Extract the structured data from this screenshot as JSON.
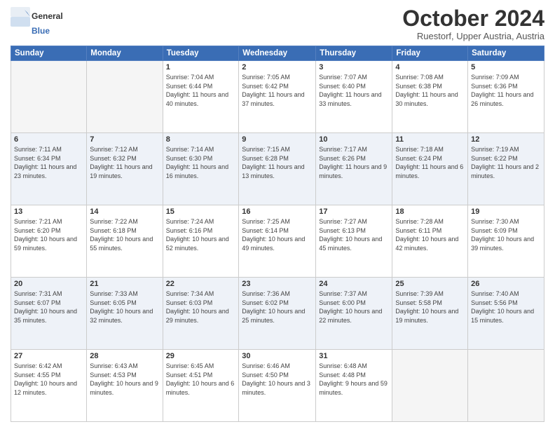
{
  "header": {
    "logo_line1": "General",
    "logo_line2": "Blue",
    "month": "October 2024",
    "location": "Ruestorf, Upper Austria, Austria"
  },
  "weekdays": [
    "Sunday",
    "Monday",
    "Tuesday",
    "Wednesday",
    "Thursday",
    "Friday",
    "Saturday"
  ],
  "weeks": [
    [
      {
        "day": "",
        "info": ""
      },
      {
        "day": "",
        "info": ""
      },
      {
        "day": "1",
        "info": "Sunrise: 7:04 AM\nSunset: 6:44 PM\nDaylight: 11 hours and 40 minutes."
      },
      {
        "day": "2",
        "info": "Sunrise: 7:05 AM\nSunset: 6:42 PM\nDaylight: 11 hours and 37 minutes."
      },
      {
        "day": "3",
        "info": "Sunrise: 7:07 AM\nSunset: 6:40 PM\nDaylight: 11 hours and 33 minutes."
      },
      {
        "day": "4",
        "info": "Sunrise: 7:08 AM\nSunset: 6:38 PM\nDaylight: 11 hours and 30 minutes."
      },
      {
        "day": "5",
        "info": "Sunrise: 7:09 AM\nSunset: 6:36 PM\nDaylight: 11 hours and 26 minutes."
      }
    ],
    [
      {
        "day": "6",
        "info": "Sunrise: 7:11 AM\nSunset: 6:34 PM\nDaylight: 11 hours and 23 minutes."
      },
      {
        "day": "7",
        "info": "Sunrise: 7:12 AM\nSunset: 6:32 PM\nDaylight: 11 hours and 19 minutes."
      },
      {
        "day": "8",
        "info": "Sunrise: 7:14 AM\nSunset: 6:30 PM\nDaylight: 11 hours and 16 minutes."
      },
      {
        "day": "9",
        "info": "Sunrise: 7:15 AM\nSunset: 6:28 PM\nDaylight: 11 hours and 13 minutes."
      },
      {
        "day": "10",
        "info": "Sunrise: 7:17 AM\nSunset: 6:26 PM\nDaylight: 11 hours and 9 minutes."
      },
      {
        "day": "11",
        "info": "Sunrise: 7:18 AM\nSunset: 6:24 PM\nDaylight: 11 hours and 6 minutes."
      },
      {
        "day": "12",
        "info": "Sunrise: 7:19 AM\nSunset: 6:22 PM\nDaylight: 11 hours and 2 minutes."
      }
    ],
    [
      {
        "day": "13",
        "info": "Sunrise: 7:21 AM\nSunset: 6:20 PM\nDaylight: 10 hours and 59 minutes."
      },
      {
        "day": "14",
        "info": "Sunrise: 7:22 AM\nSunset: 6:18 PM\nDaylight: 10 hours and 55 minutes."
      },
      {
        "day": "15",
        "info": "Sunrise: 7:24 AM\nSunset: 6:16 PM\nDaylight: 10 hours and 52 minutes."
      },
      {
        "day": "16",
        "info": "Sunrise: 7:25 AM\nSunset: 6:14 PM\nDaylight: 10 hours and 49 minutes."
      },
      {
        "day": "17",
        "info": "Sunrise: 7:27 AM\nSunset: 6:13 PM\nDaylight: 10 hours and 45 minutes."
      },
      {
        "day": "18",
        "info": "Sunrise: 7:28 AM\nSunset: 6:11 PM\nDaylight: 10 hours and 42 minutes."
      },
      {
        "day": "19",
        "info": "Sunrise: 7:30 AM\nSunset: 6:09 PM\nDaylight: 10 hours and 39 minutes."
      }
    ],
    [
      {
        "day": "20",
        "info": "Sunrise: 7:31 AM\nSunset: 6:07 PM\nDaylight: 10 hours and 35 minutes."
      },
      {
        "day": "21",
        "info": "Sunrise: 7:33 AM\nSunset: 6:05 PM\nDaylight: 10 hours and 32 minutes."
      },
      {
        "day": "22",
        "info": "Sunrise: 7:34 AM\nSunset: 6:03 PM\nDaylight: 10 hours and 29 minutes."
      },
      {
        "day": "23",
        "info": "Sunrise: 7:36 AM\nSunset: 6:02 PM\nDaylight: 10 hours and 25 minutes."
      },
      {
        "day": "24",
        "info": "Sunrise: 7:37 AM\nSunset: 6:00 PM\nDaylight: 10 hours and 22 minutes."
      },
      {
        "day": "25",
        "info": "Sunrise: 7:39 AM\nSunset: 5:58 PM\nDaylight: 10 hours and 19 minutes."
      },
      {
        "day": "26",
        "info": "Sunrise: 7:40 AM\nSunset: 5:56 PM\nDaylight: 10 hours and 15 minutes."
      }
    ],
    [
      {
        "day": "27",
        "info": "Sunrise: 6:42 AM\nSunset: 4:55 PM\nDaylight: 10 hours and 12 minutes."
      },
      {
        "day": "28",
        "info": "Sunrise: 6:43 AM\nSunset: 4:53 PM\nDaylight: 10 hours and 9 minutes."
      },
      {
        "day": "29",
        "info": "Sunrise: 6:45 AM\nSunset: 4:51 PM\nDaylight: 10 hours and 6 minutes."
      },
      {
        "day": "30",
        "info": "Sunrise: 6:46 AM\nSunset: 4:50 PM\nDaylight: 10 hours and 3 minutes."
      },
      {
        "day": "31",
        "info": "Sunrise: 6:48 AM\nSunset: 4:48 PM\nDaylight: 9 hours and 59 minutes."
      },
      {
        "day": "",
        "info": ""
      },
      {
        "day": "",
        "info": ""
      }
    ]
  ]
}
